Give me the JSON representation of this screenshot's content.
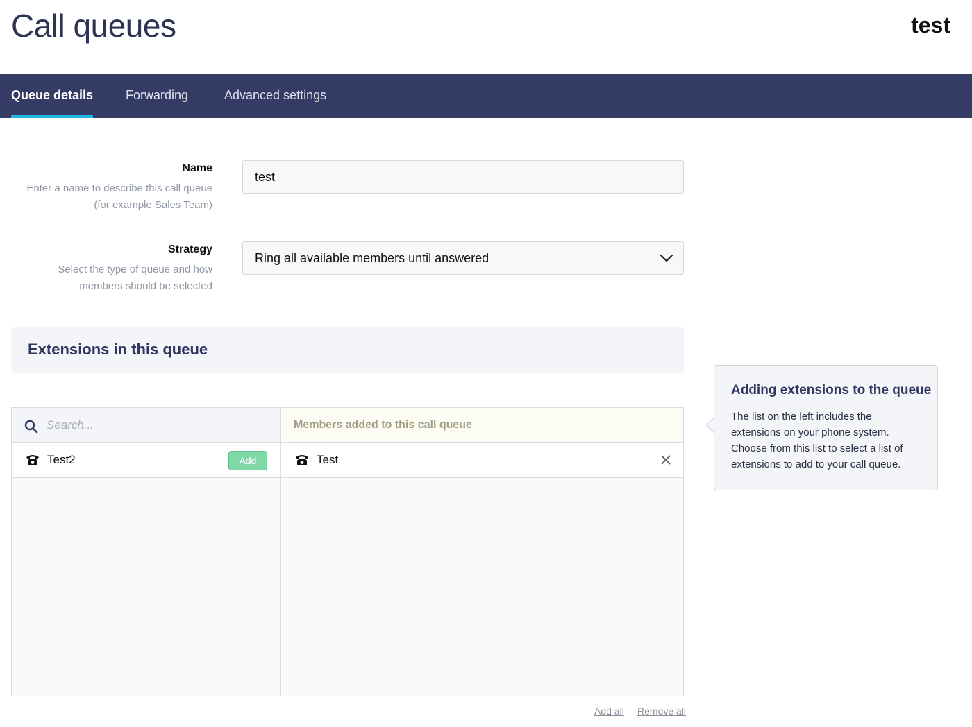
{
  "header": {
    "title": "Call queues",
    "account_name": "test"
  },
  "tabs": [
    {
      "label": "Queue details",
      "active": true
    },
    {
      "label": "Forwarding",
      "active": false
    },
    {
      "label": "Advanced settings",
      "active": false
    }
  ],
  "form": {
    "name": {
      "label": "Name",
      "hint_line1": "Enter a name to describe this call queue",
      "hint_line2": "(for example Sales Team)",
      "value": "test"
    },
    "strategy": {
      "label": "Strategy",
      "hint_line1": "Select the type of queue and how",
      "hint_line2": "members should be selected",
      "value": "Ring all available members until answered"
    }
  },
  "extensions": {
    "section_title": "Extensions in this queue",
    "search_placeholder": "Search...",
    "members_header": "Members added to this call queue",
    "available": [
      {
        "name": "Test2",
        "icon": "phone-icon",
        "action_label": "Add"
      }
    ],
    "members": [
      {
        "name": "Test",
        "icon": "phone-icon"
      }
    ],
    "add_all_label": "Add all",
    "remove_all_label": "Remove all"
  },
  "help": {
    "title": "Adding extensions to the queue",
    "body": "The list on the left includes the extensions on your phone system. Choose from this list to select a list of extensions to add to your call queue."
  },
  "colors": {
    "navbar": "#343b65",
    "tab_indicator": "#1eb8e4",
    "heading": "#2f3660",
    "add_button": "#7fd8a6"
  }
}
